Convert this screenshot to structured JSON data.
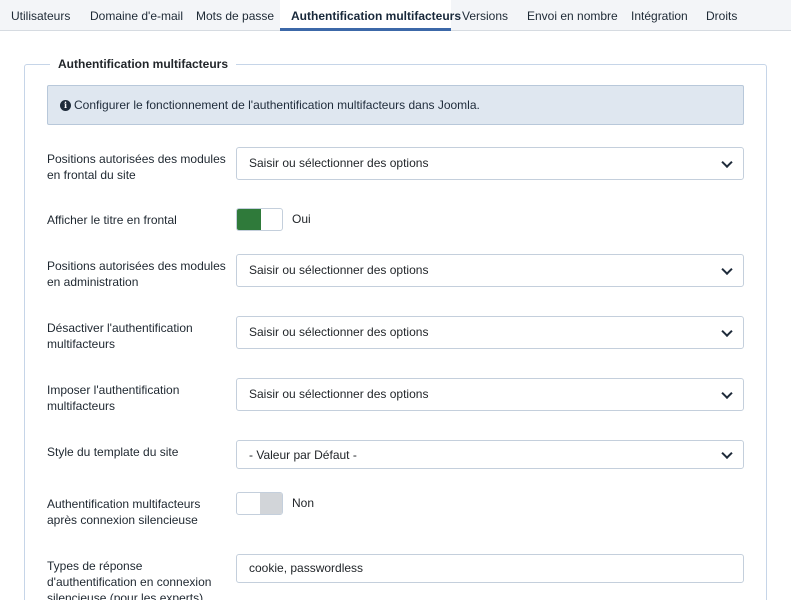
{
  "tabs": [
    {
      "label": "Utilisateurs"
    },
    {
      "label": "Domaine d'e-mail"
    },
    {
      "label": "Mots de passe"
    },
    {
      "label": "Authentification multifacteurs",
      "active": true
    },
    {
      "label": "Versions"
    },
    {
      "label": "Envoi en nombre"
    },
    {
      "label": "Intégration"
    },
    {
      "label": "Droits"
    }
  ],
  "fieldset": {
    "legend": "Authentification multifacteurs",
    "alert": "Configurer le fonctionnement de l'authentification multifacteurs dans Joomla."
  },
  "fields": {
    "frontend_positions": {
      "label": "Positions autorisées des modules en frontal du site",
      "placeholder": "Saisir ou sélectionner des options"
    },
    "show_title": {
      "label": "Afficher le titre en frontal",
      "value": "Oui"
    },
    "admin_positions": {
      "label": "Positions autorisées des modules en administration",
      "placeholder": "Saisir ou sélectionner des options"
    },
    "disable_mfa": {
      "label": "Désactiver l'authentification multifacteurs",
      "placeholder": "Saisir ou sélectionner des options"
    },
    "force_mfa": {
      "label": "Imposer l'authentification multifacteurs",
      "placeholder": "Saisir ou sélectionner des options"
    },
    "template_style": {
      "label": "Style du template du site",
      "value": "- Valeur par Défaut -"
    },
    "silent_mfa": {
      "label": "Authentification multifacteurs après connexion silencieuse",
      "value": "Non"
    },
    "silent_types": {
      "label": "Types de réponse d'authentification en connexion silencieuse (pour les experts)",
      "value": "cookie, passwordless"
    }
  },
  "colors": {
    "accent": "#3c68a8",
    "toggle_on": "#2f7a3a",
    "toggle_off": "#d2d5d9",
    "alert_bg": "#dfe7f0"
  }
}
